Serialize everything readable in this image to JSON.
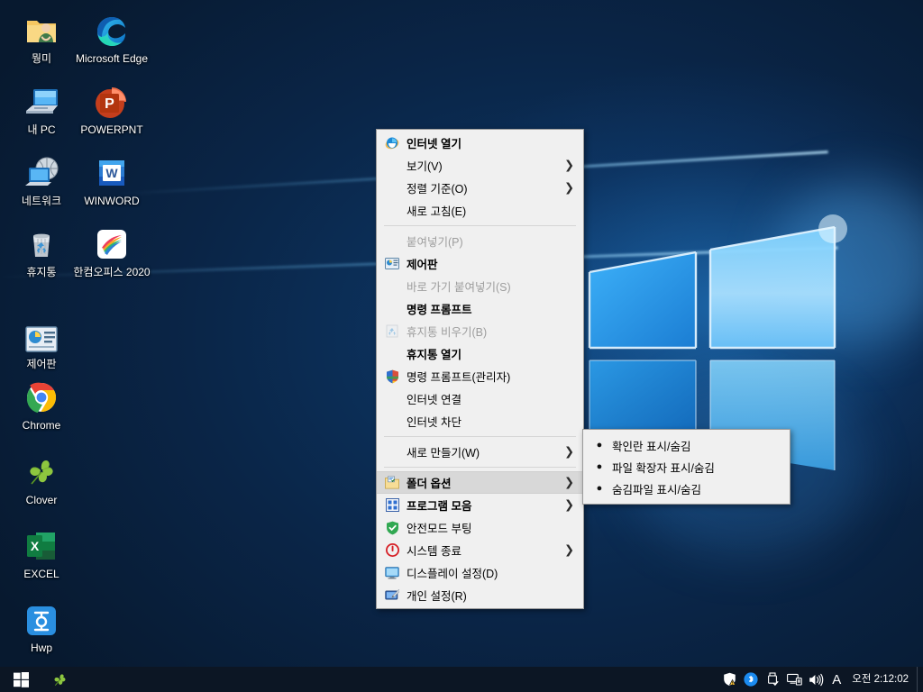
{
  "desktop": {
    "icons": [
      {
        "name": "뭥미",
        "icon": "user-folder-icon",
        "col": 1,
        "row": 1
      },
      {
        "name": "Microsoft Edge",
        "icon": "edge-icon",
        "col": 2,
        "row": 1
      },
      {
        "name": "내 PC",
        "icon": "this-pc-icon",
        "col": 1,
        "row": 2
      },
      {
        "name": "POWERPNT",
        "icon": "powerpoint-icon",
        "col": 2,
        "row": 2
      },
      {
        "name": "네트워크",
        "icon": "network-icon",
        "col": 1,
        "row": 3
      },
      {
        "name": "WINWORD",
        "icon": "word-icon",
        "col": 2,
        "row": 3
      },
      {
        "name": "휴지통",
        "icon": "recycle-bin-icon",
        "col": 1,
        "row": 4
      },
      {
        "name": "한컴오피스 2020",
        "icon": "hancom-office-icon",
        "col": 2,
        "row": 4
      },
      {
        "name": "제어판",
        "icon": "control-panel-icon",
        "col": 1,
        "row": 5
      },
      {
        "name": "Chrome",
        "icon": "chrome-icon",
        "col": 1,
        "row": 6
      },
      {
        "name": "Clover",
        "icon": "clover-icon",
        "col": 1,
        "row": 7
      },
      {
        "name": "EXCEL",
        "icon": "excel-icon",
        "col": 1,
        "row": 8
      },
      {
        "name": "Hwp",
        "icon": "hwp-icon",
        "col": 1,
        "row": 9
      }
    ]
  },
  "context_menu": {
    "items": [
      {
        "label": "인터넷 열기",
        "icon": "internet-explorer-icon",
        "bold": true,
        "disabled": false,
        "submenu": false,
        "separator_after": false
      },
      {
        "label": "보기(V)",
        "icon": "",
        "bold": false,
        "disabled": false,
        "submenu": true,
        "separator_after": false
      },
      {
        "label": "정렬 기준(O)",
        "icon": "",
        "bold": false,
        "disabled": false,
        "submenu": true,
        "separator_after": false
      },
      {
        "label": "새로 고침(E)",
        "icon": "",
        "bold": false,
        "disabled": false,
        "submenu": false,
        "separator_after": true
      },
      {
        "label": "붙여넣기(P)",
        "icon": "",
        "bold": false,
        "disabled": true,
        "submenu": false,
        "separator_after": false
      },
      {
        "label": "제어판",
        "icon": "control-panel-icon",
        "bold": true,
        "disabled": false,
        "submenu": false,
        "separator_after": false
      },
      {
        "label": "바로 가기 붙여넣기(S)",
        "icon": "",
        "bold": false,
        "disabled": true,
        "submenu": false,
        "separator_after": false
      },
      {
        "label": "명령 프롬프트",
        "icon": "",
        "bold": true,
        "disabled": false,
        "submenu": false,
        "separator_after": false
      },
      {
        "label": "휴지통 비우기(B)",
        "icon": "recycle-bin-small-icon",
        "bold": false,
        "disabled": true,
        "submenu": false,
        "separator_after": false
      },
      {
        "label": "휴지통 열기",
        "icon": "",
        "bold": true,
        "disabled": false,
        "submenu": false,
        "separator_after": false
      },
      {
        "label": "명령 프롬프트(관리자)",
        "icon": "shield-uac-icon",
        "bold": false,
        "disabled": false,
        "submenu": false,
        "separator_after": false
      },
      {
        "label": "인터넷 연결",
        "icon": "",
        "bold": false,
        "disabled": false,
        "submenu": false,
        "separator_after": false
      },
      {
        "label": "인터넷 차단",
        "icon": "",
        "bold": false,
        "disabled": false,
        "submenu": false,
        "separator_after": true
      },
      {
        "label": "새로 만들기(W)",
        "icon": "",
        "bold": false,
        "disabled": false,
        "submenu": true,
        "separator_after": true
      },
      {
        "label": "폴더 옵션",
        "icon": "folder-options-icon",
        "bold": true,
        "disabled": false,
        "submenu": true,
        "separator_after": false,
        "highlighted": true
      },
      {
        "label": "프로그램 모음",
        "icon": "programs-grid-icon",
        "bold": true,
        "disabled": false,
        "submenu": true,
        "separator_after": false
      },
      {
        "label": "안전모드 부팅",
        "icon": "green-shield-icon",
        "bold": false,
        "disabled": false,
        "submenu": false,
        "separator_after": false
      },
      {
        "label": "시스템 종료",
        "icon": "power-icon",
        "bold": false,
        "disabled": false,
        "submenu": true,
        "separator_after": false
      },
      {
        "label": "디스플레이 설정(D)",
        "icon": "display-icon",
        "bold": false,
        "disabled": false,
        "submenu": false,
        "separator_after": false
      },
      {
        "label": "개인 설정(R)",
        "icon": "personalize-icon",
        "bold": false,
        "disabled": false,
        "submenu": false,
        "separator_after": false
      }
    ]
  },
  "submenu": {
    "parent": "폴더 옵션",
    "items": [
      {
        "label": "확인란 표시/숨김"
      },
      {
        "label": "파일 확장자 표시/숨김"
      },
      {
        "label": "숨김파일 표시/숨김"
      }
    ]
  },
  "taskbar": {
    "start_label": "start-button",
    "tasks": [
      {
        "name": "Clover",
        "icon": "clover-icon"
      }
    ],
    "tray": [
      {
        "icon": "security-shield-warning-icon",
        "name": "보안 및 유지 관리"
      },
      {
        "icon": "bluetooth-icon",
        "name": "Bluetooth"
      },
      {
        "icon": "safely-remove-hardware-icon",
        "name": "하드웨어 안전하게 제거"
      },
      {
        "icon": "network-monitor-icon",
        "name": "네트워크"
      },
      {
        "icon": "volume-icon",
        "name": "볼륨"
      }
    ],
    "ime": "A",
    "clock": "오전 2:12:02"
  },
  "colors": {
    "menu_bg": "#f0f0f0",
    "menu_border": "#9a9a9a",
    "menu_highlight": "#d8d8d8",
    "disabled_text": "#9d9d9d",
    "taskbar_bg": "#0c1624",
    "desktop_blue": "#0d3a6b"
  }
}
